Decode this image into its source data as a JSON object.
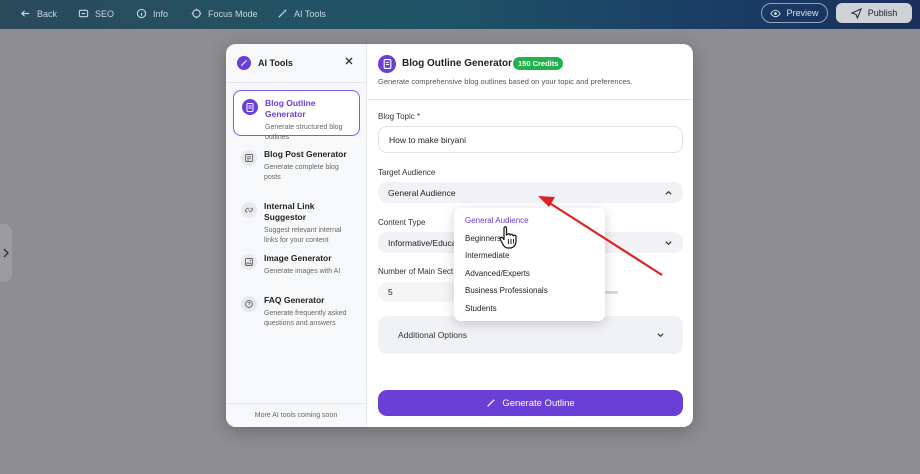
{
  "topbar": {
    "back": "Back",
    "seo": "SEO",
    "info": "Info",
    "focus_mode": "Focus Mode",
    "ai_tools": "AI Tools",
    "preview": "Preview",
    "publish": "Publish"
  },
  "modal": {
    "left": {
      "title": "AI Tools",
      "tools": [
        {
          "name": "Blog Outline Generator",
          "desc": "Generate structured blog outlines",
          "active": true
        },
        {
          "name": "Blog Post Generator",
          "desc": "Generate complete blog posts"
        },
        {
          "name": "Internal Link Suggestor",
          "desc": "Suggest relevant internal links for your content"
        },
        {
          "name": "Image Generator",
          "desc": "Generate images with AI"
        },
        {
          "name": "FAQ Generator",
          "desc": "Generate frequently asked questions and answers"
        }
      ],
      "footer": "More AI tools coming soon"
    },
    "right": {
      "title": "Blog Outline Generator",
      "credits": "150 Credits",
      "subtitle": "Generate comprehensive blog outlines based on your topic and preferences.",
      "blog_topic_label": "Blog Topic *",
      "blog_topic_value": "How to make biryani",
      "target_audience_label": "Target Audience",
      "target_audience_value": "General Audience",
      "content_type_label": "Content Type",
      "content_type_value": "Informative/Educa",
      "sections_label": "Number of Main Sect",
      "sections_value": "5",
      "additional_options": "Additional Options",
      "generate_button": "Generate Outline"
    }
  },
  "dropdown": {
    "options": [
      "General Audience",
      "Beginners",
      "Intermediate",
      "Advanced/Experts",
      "Business Professionals",
      "Students"
    ],
    "selected_index": 0
  },
  "colors": {
    "accent": "#6a3fd8",
    "credits_badge": "#22b14c",
    "annotation_arrow": "#e02020"
  }
}
